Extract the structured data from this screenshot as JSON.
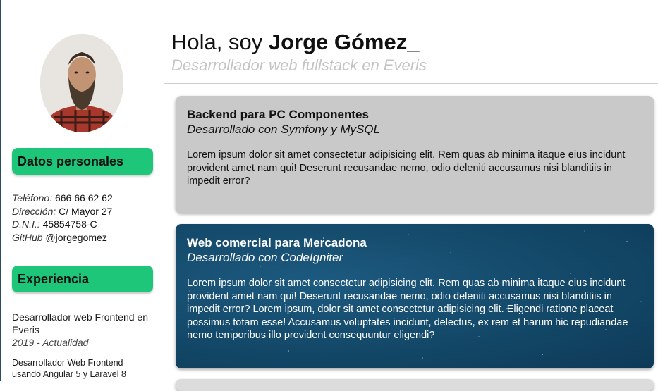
{
  "header": {
    "greeting": "Hola, soy ",
    "name": "Jorge Gómez_",
    "subtitle": "Desarrollador web fullstack en Everis"
  },
  "sidebar": {
    "personal_title": "Datos personales",
    "personal": [
      {
        "label": "Teléfono:",
        "value": "666 66 62 62"
      },
      {
        "label": "Dirección:",
        "value": "C/ Mayor 27"
      },
      {
        "label": "D.N.I.:",
        "value": "45854758-C"
      },
      {
        "label": "GitHub",
        "value": "@jorgegomez"
      }
    ],
    "experience_title": "Experiencia",
    "job": {
      "role": "Desarrollador web Frontend en Everis",
      "period": "2019 - Actualidad",
      "description": "Desarrollador Web Frontend usando Angular 5 y Laravel 8"
    }
  },
  "projects": [
    {
      "title": "Backend para PC Componentes",
      "tech": "Desarrollado con Symfony y MySQL",
      "body": "Lorem ipsum dolor sit amet consectetur adipisicing elit. Rem quas ab minima itaque eius incidunt provident amet nam qui! Deserunt recusandae nemo, odio deleniti accusamus nisi blanditiis in impedit error?"
    },
    {
      "title": "Web comercial para Mercadona",
      "tech": "Desarrollado con CodeIgniter",
      "body": "Lorem ipsum dolor sit amet consectetur adipisicing elit. Rem quas ab minima itaque eius incidunt provident amet nam qui! Deserunt recusandae nemo, odio deleniti accusamus nisi blanditiis in impedit error? Lorem ipsum, dolor sit amet consectetur adipisicing elit. Eligendi ratione placeat possimus totam esse! Accusamus voluptates incidunt, delectus, ex rem et harum hic repudiandae nemo temporibus illo provident consequuntur eligendi?"
    }
  ],
  "colors": {
    "accent": "#1ec67a",
    "card_gray": "#c9c9c9",
    "card_blue": "#134868",
    "subtitle_gray": "#c4c4c4"
  },
  "icons": {
    "avatar": "profile-photo"
  }
}
